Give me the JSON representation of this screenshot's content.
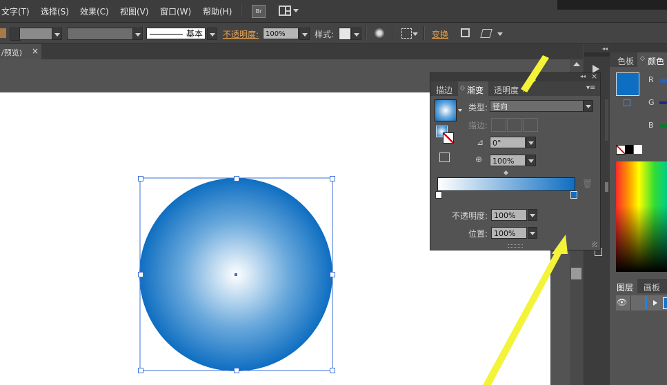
{
  "menu": {
    "items": [
      "文字(T)",
      "选择(S)",
      "效果(C)",
      "视图(V)",
      "窗口(W)",
      "帮助(H)"
    ],
    "br_badge": "Br"
  },
  "control_bar": {
    "stroke_style_label": "基本",
    "opacity_label": "不透明度:",
    "opacity_value": "100%",
    "style_label": "样式:",
    "transform_label": "变换"
  },
  "document_tab": {
    "title": "/预览)",
    "close": "×"
  },
  "gradient_panel": {
    "tabs": [
      "描边",
      "渐变",
      "透明度"
    ],
    "active_tab": "渐变",
    "type_label": "类型:",
    "type_value": "径向",
    "stroke_label": "描边:",
    "angle_value": "0°",
    "aspect_value": "100%",
    "opacity_label": "不透明度:",
    "opacity_value": "100%",
    "location_label": "位置:",
    "location_value": "100%",
    "gradient_stops": [
      {
        "location": 0,
        "color": "#ffffff"
      },
      {
        "location": 100,
        "color": "#0e6ec1"
      }
    ],
    "selected_stop_location": 100
  },
  "color_panel": {
    "tabs": [
      "色板",
      "颜色"
    ],
    "channels": [
      "R",
      "G",
      "B"
    ],
    "fill_color": "#0e6ec1"
  },
  "layers_panel": {
    "tabs": [
      "图层",
      "画板"
    ]
  },
  "artwork": {
    "shape": "circle",
    "fill_type": "radial-gradient",
    "center_color": "#ffffff",
    "edge_color": "#0e6ec1"
  },
  "colors": {
    "accent_orange": "#e8a04a",
    "annotation_arrow": "#f3f33a",
    "selection_blue": "#3a6fd6"
  }
}
